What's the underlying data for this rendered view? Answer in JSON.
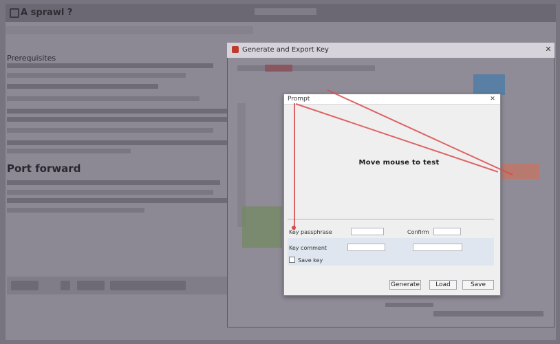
{
  "background_app": {
    "title": "A sprawl ?",
    "heading": "Prerequisites",
    "section_heading": "Port forward"
  },
  "mid_dialog": {
    "title": "Generate and Export Key"
  },
  "modal": {
    "title": "Prompt",
    "message": "Move mouse to test",
    "row1_label": "Key passphrase",
    "row1_extra": "Confirm",
    "row2_label": "Key comment",
    "checkbox_label": "Save key",
    "buttons": {
      "generate": "Generate",
      "load": "Load",
      "save": "Save"
    }
  },
  "colors": {
    "accent_red": "#d94b4b",
    "dim_background": "#77737f",
    "dialog_bg": "#f0efef"
  }
}
